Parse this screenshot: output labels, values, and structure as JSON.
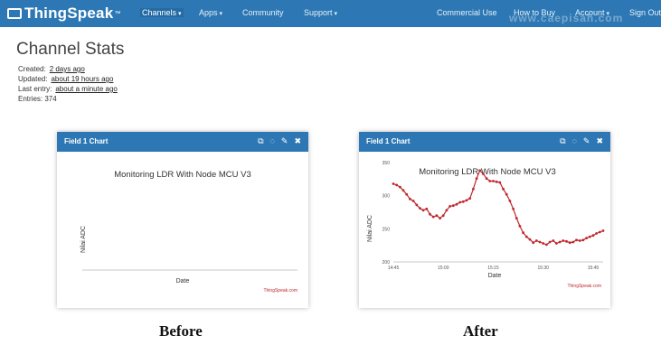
{
  "nav": {
    "brand": "ThingSpeak",
    "brand_tm": "™",
    "left_items": [
      "Channels",
      "Apps",
      "Community",
      "Support"
    ],
    "right_items": [
      "Commercial Use",
      "How to Buy",
      "Account",
      "Sign Out"
    ],
    "watermark": "www.caepisah.com",
    "bg_color": "#2d78b4"
  },
  "page": {
    "title": "Channel Stats",
    "created_label": "Created:",
    "created_value": "2 days ago",
    "updated_label": "Updated:",
    "updated_value": "about 19 hours ago",
    "last_entry_label": "Last entry:",
    "last_entry_value": "about a minute ago",
    "entries_label": "Entries:",
    "entries_value": "374"
  },
  "panels": [
    {
      "header": "Field 1 Chart",
      "caption": "Before"
    },
    {
      "header": "Field 1 Chart",
      "caption": "After"
    }
  ],
  "icons": [
    "external-link-icon",
    "comment-icon",
    "pencil-icon",
    "close-icon"
  ],
  "chart_data": [
    {
      "type": "line",
      "title": "Monitoring LDR With Node MCU V3",
      "xlabel": "Date",
      "ylabel": "Nilai ADC",
      "credit": "ThingSpeak.com",
      "series": [],
      "grid": false
    },
    {
      "type": "line",
      "title": "Monitoring LDR With Node MCU V3",
      "xlabel": "Date",
      "ylabel": "Nilai ADC",
      "credit": "ThingSpeak.com",
      "ylim": [
        200,
        350
      ],
      "yticks": [
        200,
        250,
        300,
        350
      ],
      "xlim": [
        "14:45",
        "15:48"
      ],
      "xticks": [
        "14:45",
        "15:00",
        "15:15",
        "15:30",
        "15:45"
      ],
      "color": "#c0272d",
      "series": [
        {
          "x": [
            "14:45",
            "14:46",
            "14:47",
            "14:48",
            "14:49",
            "14:50",
            "14:51",
            "14:52",
            "14:53",
            "14:54",
            "14:55",
            "14:56",
            "14:57",
            "14:58",
            "14:59",
            "15:00",
            "15:01",
            "15:02",
            "15:03",
            "15:04",
            "15:05",
            "15:06",
            "15:07",
            "15:08",
            "15:09",
            "15:10",
            "15:11",
            "15:12",
            "15:13",
            "15:14",
            "15:15",
            "15:16",
            "15:17",
            "15:18",
            "15:19",
            "15:20",
            "15:21",
            "15:22",
            "15:23",
            "15:24",
            "15:25",
            "15:26",
            "15:27",
            "15:28",
            "15:29",
            "15:30",
            "15:31",
            "15:32",
            "15:33",
            "15:34",
            "15:35",
            "15:36",
            "15:37",
            "15:38",
            "15:39",
            "15:40",
            "15:41",
            "15:42",
            "15:43",
            "15:44",
            "15:45",
            "15:46",
            "15:47",
            "15:48"
          ],
          "y": [
            318,
            316,
            313,
            308,
            302,
            295,
            292,
            286,
            281,
            278,
            280,
            272,
            268,
            270,
            266,
            270,
            278,
            284,
            285,
            287,
            290,
            291,
            293,
            296,
            310,
            326,
            338,
            333,
            326,
            322,
            322,
            321,
            320,
            310,
            302,
            292,
            280,
            266,
            254,
            244,
            238,
            234,
            229,
            232,
            230,
            228,
            226,
            230,
            232,
            228,
            230,
            232,
            231,
            229,
            230,
            233,
            232,
            233,
            236,
            238,
            240,
            243,
            245,
            247
          ]
        }
      ]
    }
  ]
}
